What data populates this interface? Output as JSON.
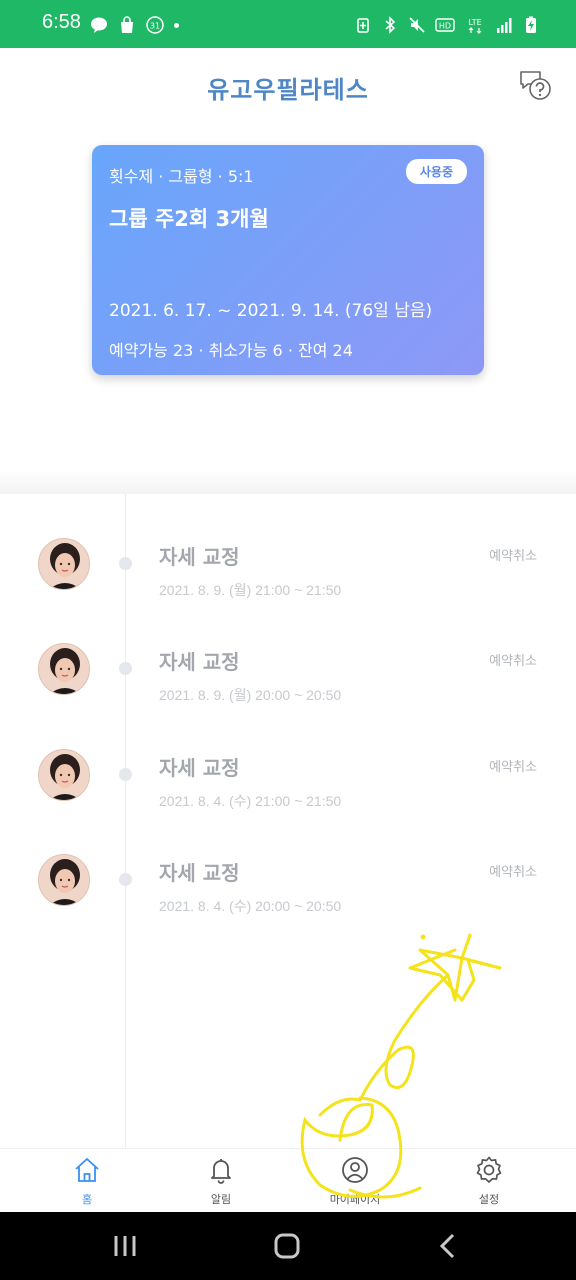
{
  "status_bar": {
    "time": "6:58",
    "left_icons": [
      "talk-icon",
      "shopping-bag-icon",
      "calendar-31-icon"
    ],
    "right_icons": [
      "battery-saver-icon",
      "bluetooth-icon",
      "mute-icon",
      "hd-icon",
      "lte-icon",
      "signal-icon",
      "battery-charging-icon"
    ],
    "calendar_day": "31",
    "hd_label": "HD",
    "lte_label": "LTE",
    "color": "#1fb866"
  },
  "header": {
    "title": "유고우필라테스",
    "help_icon": "chat-question-icon"
  },
  "card": {
    "type_line": "횟수제 · 그룹형 · 5:1",
    "badge": "사용중",
    "title": "그룹 주2회 3개월",
    "period": "2021. 6. 17. ~ 2021. 9. 14.  (76일 남음)",
    "counts": "예약가능 23 · 취소가능 6 · 잔여 24"
  },
  "bookings": [
    {
      "title": "자세 교정",
      "datetime": "2021. 8. 9. (월) 21:00 ~ 21:50",
      "action": "예약취소"
    },
    {
      "title": "자세 교정",
      "datetime": "2021. 8. 9. (월) 20:00 ~ 20:50",
      "action": "예약취소"
    },
    {
      "title": "자세 교정",
      "datetime": "2021. 8. 4. (수) 21:00 ~ 21:50",
      "action": "예약취소"
    },
    {
      "title": "자세 교정",
      "datetime": "2021. 8. 4. (수) 20:00 ~ 20:50",
      "action": "예약취소"
    }
  ],
  "bottom_nav": [
    {
      "label": "홈",
      "icon": "home-icon",
      "active": true
    },
    {
      "label": "알림",
      "icon": "bell-icon",
      "active": false
    },
    {
      "label": "마이페이지",
      "icon": "user-icon",
      "active": false
    },
    {
      "label": "설정",
      "icon": "gear-icon",
      "active": false
    }
  ],
  "system_nav": [
    "recents-icon",
    "home-circle-icon",
    "back-icon"
  ],
  "colors": {
    "accent": "#3a8ff0",
    "title_blue": "#4f86c6",
    "card_gradient_start": "#68a6fb",
    "card_gradient_end": "#8e98f6",
    "doodle_yellow": "#f4e31a"
  }
}
